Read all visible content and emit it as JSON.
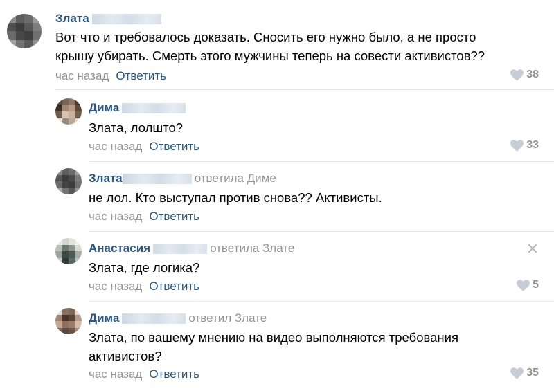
{
  "comments": [
    {
      "author": "Злата",
      "replied_to": "",
      "text_lines": [
        "Вот что и требовалось доказать. Сносить его нужно было, а не просто",
        "крышу убирать. Смерть этого мужчины теперь на совести активистов??"
      ],
      "time": "час назад",
      "reply_label": "Ответить",
      "likes": "38"
    },
    {
      "author": "Дима",
      "replied_to": "",
      "text_lines": [
        "Злата, лолшто?"
      ],
      "time": "час назад",
      "reply_label": "Ответить",
      "likes": "33"
    },
    {
      "author": "Злата",
      "replied_to": "ответила Диме",
      "text_lines": [
        "не лол. Кто выступал против снова?? Активисты."
      ],
      "time": "час назад",
      "reply_label": "Ответить",
      "likes": ""
    },
    {
      "author": "Анастасия",
      "replied_to": "ответила Злате",
      "text_lines": [
        "Злата, где логика?"
      ],
      "time": "час назад",
      "reply_label": "Ответить",
      "likes": "5"
    },
    {
      "author": "Дима",
      "replied_to": "ответил Злате",
      "text_lines": [
        "Злата, по вашему мнению на видео выполняются требования",
        "активистов?"
      ],
      "time": "час назад",
      "reply_label": "Ответить",
      "likes": "35"
    }
  ],
  "colors": {
    "link": "#2a5885",
    "muted": "#939393",
    "separator": "#e7e8ec"
  },
  "icons": {
    "like": "heart-icon",
    "delete": "close-icon"
  }
}
